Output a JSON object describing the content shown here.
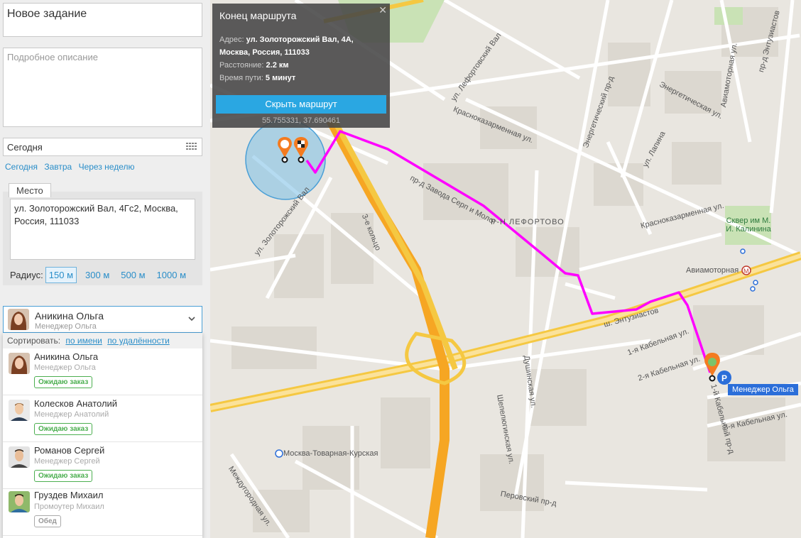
{
  "task": {
    "title": "Новое задание",
    "description_placeholder": "Подробное описание",
    "date": "Сегодня",
    "quick_dates": [
      "Сегодня",
      "Завтра",
      "Через неделю"
    ]
  },
  "place": {
    "tab_label": "Место",
    "address": "ул. Золоторожский Вал, 4Гс2, Москва, Россия, 111033",
    "radius_label": "Радиус:",
    "radius_options": [
      "150 м",
      "300 м",
      "500 м",
      "1000 м"
    ],
    "radius_selected": "150 м"
  },
  "assignee": {
    "name": "Аникина Ольга",
    "role": "Менеджер Ольга"
  },
  "dropdown": {
    "sort_label": "Сортировать:",
    "sort_by_name": "по имени",
    "sort_by_distance": "по удалённости",
    "users": [
      {
        "name": "Аникина Ольга",
        "role": "Менеджер Ольга",
        "status": "Ожидаю заказ"
      },
      {
        "name": "Колесков Анатолий",
        "role": "Менеджер Анатолий",
        "status": "Ожидаю заказ"
      },
      {
        "name": "Романов Сергей",
        "role": "Менеджер Сергей",
        "status": "Ожидаю заказ"
      },
      {
        "name": "Груздев Михаил",
        "role": "Промоутер Михаил",
        "status": "Обед"
      }
    ]
  },
  "popup": {
    "title": "Конец маршрута",
    "address_label": "Адрес:",
    "address": "ул. Золоторожский Вал, 4А, Москва, Россия, 111033",
    "distance_label": "Расстояние:",
    "distance": "2.2 км",
    "time_label": "Время пути:",
    "time": "5 минут",
    "button": "Скрыть маршрут",
    "coords": "55.755331, 37.690461"
  },
  "map": {
    "marker_label": "Менеджер Ольга",
    "route_color": "#ff00ff",
    "streets": [
      "ул. Лефортовский Вал",
      "Краснока­зарменная ул.",
      "Энергетический пр-д",
      "Энергетическая ул.",
      "Авиамоторная ул.",
      "пр-д Энтузиастов",
      "Р-Н ЛЕФОРТОВО",
      "Красноказарменная ул.",
      "ул. Золоторожский Вал",
      "3-е кольцо",
      "ш. Энтузиастов",
      "1-я Кабельная ул.",
      "2-я Кабельная ул.",
      "3-я Кабельная ул.",
      "Москва-Товарная-Курская",
      "Шепелюгинская ул.",
      "Душинская ул.",
      "Перовский пр-д",
      "Междугородная ул.",
      "Авиамоторная",
      "Сквер им М. И. Калинина",
      "ул. Лапина",
      "пр-д Завода Серп и Молот",
      "1-й Кабельный пр-д"
    ]
  }
}
